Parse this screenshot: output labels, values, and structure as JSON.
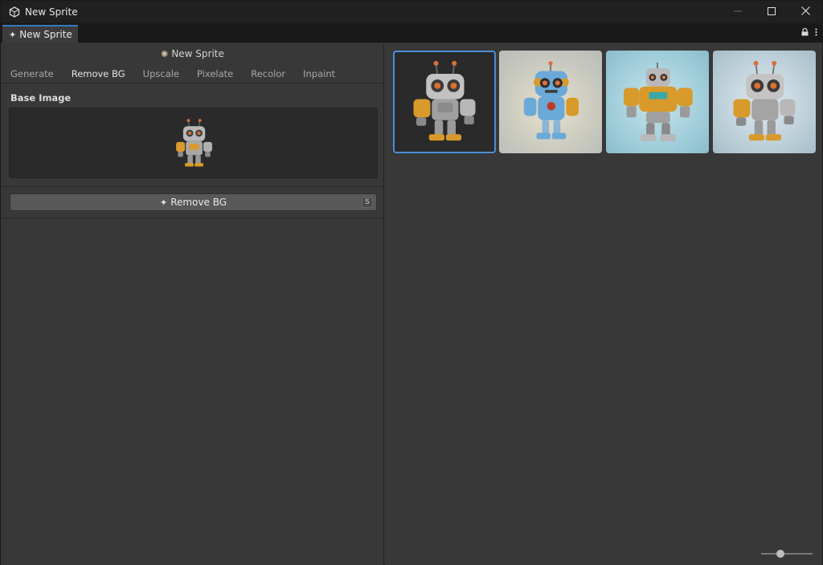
{
  "window": {
    "title": "New Sprite",
    "controls": [
      "minimize-icon",
      "maximize-icon",
      "close-icon"
    ]
  },
  "tabbar": {
    "tab_label": "New Sprite",
    "tools": [
      "lock-icon",
      "more-vertical-icon"
    ]
  },
  "left_panel": {
    "header_title": "New Sprite",
    "tool_tabs": [
      {
        "label": "Generate",
        "active": false
      },
      {
        "label": "Remove BG",
        "active": true
      },
      {
        "label": "Upscale",
        "active": false
      },
      {
        "label": "Pixelate",
        "active": false
      },
      {
        "label": "Recolor",
        "active": false
      },
      {
        "label": "Inpaint",
        "active": false
      }
    ],
    "base_image_label": "Base Image",
    "action_button_label": "Remove BG",
    "action_shortcut": "S"
  },
  "gallery": {
    "thumbnails": [
      {
        "name": "robot-sprite-1",
        "selected": true
      },
      {
        "name": "robot-sprite-2",
        "selected": false
      },
      {
        "name": "robot-sprite-3",
        "selected": false
      },
      {
        "name": "robot-sprite-4",
        "selected": false
      }
    ],
    "zoom_level": 0.35
  },
  "colors": {
    "accent": "#4a8fd8",
    "panel_bg": "#383838",
    "titlebar_bg": "#202020",
    "robot_body": "#b8b8b8",
    "robot_gold": "#d89a2a",
    "robot_blue": "#6aa9d8"
  }
}
